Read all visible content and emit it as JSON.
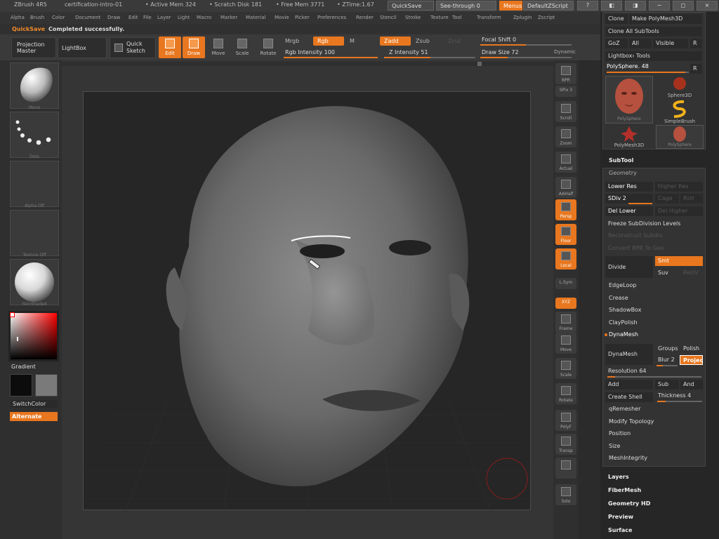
{
  "titlebar": {
    "app": "ZBrush 4R5",
    "file": "certification-intro-01",
    "active_mem": "• Active Mem 324",
    "scratch": "• Scratch Disk 181",
    "free_mem": "• Free Mem 3771",
    "ztime": "• ZTime:1.67",
    "quicksave": "QuickSave",
    "seethrough": "See-through 0",
    "menus": "Menus",
    "script": "DefaultZScript",
    "win_icons": [
      "?",
      "◧",
      "◨",
      "−",
      "◻",
      "×"
    ]
  },
  "menubar": [
    "Alpha",
    "Brush",
    "Color",
    "Document",
    "Draw",
    "Edit",
    "File",
    "Layer",
    "Light",
    "Macro",
    "Marker",
    "Material",
    "Movie",
    "Picker",
    "Preferences",
    "Render",
    "Stencil",
    "Stroke",
    "Texture",
    "Tool",
    "Transform",
    "Zplugin",
    "Zscript"
  ],
  "status": {
    "prefix": "QuickSave",
    "text": "Completed successfully."
  },
  "toolbar": {
    "projection_master": "Projection Master",
    "lightbox": "LightBox",
    "quick_sketch": "Quick Sketch",
    "edit": "Edit",
    "draw": "Draw",
    "move": "Move",
    "scale": "Scale",
    "rotate": "Rotate",
    "mrgb": "Mrgb",
    "rgb": "Rgb",
    "m": "M",
    "rgb_intensity": "Rgb Intensity 100",
    "rgb_intensity_value": 1.0,
    "zadd": "Zadd",
    "zsub": "Zsub",
    "zcut": "Zcut",
    "z_intensity": "Z Intensity 51",
    "z_intensity_value": 0.51,
    "focal_shift": "Focal Shift 0",
    "draw_size": "Draw Size 72",
    "dynamic": "Dynamic"
  },
  "leftshelf": {
    "brush_label": "Move",
    "stroke_label": "Dots",
    "alpha_label": "Alpha Off",
    "texture_label": "Texture Off",
    "material_label": "SkinShade4",
    "gradient": "Gradient",
    "switch_color": "SwitchColor",
    "alternate": "Alternate"
  },
  "rightshelf": [
    {
      "name": "bpr",
      "label": "BPR",
      "on": false
    },
    {
      "name": "spix",
      "label": "SPix 3",
      "on": false
    },
    {
      "name": "scroll",
      "label": "Scroll",
      "on": false
    },
    {
      "name": "zoom",
      "label": "Zoom",
      "on": false
    },
    {
      "name": "actual",
      "label": "Actual",
      "on": false
    },
    {
      "name": "aahalf",
      "label": "AAHalf",
      "on": false
    },
    {
      "name": "persp",
      "label": "Persp",
      "on": true
    },
    {
      "name": "floor",
      "label": "Floor",
      "on": true
    },
    {
      "name": "local",
      "label": "Local",
      "on": true
    },
    {
      "name": "lsym",
      "label": "L.Sym",
      "on": false
    },
    {
      "name": "xyz",
      "label": "XYZ",
      "on": true
    },
    {
      "name": "frame",
      "label": "Frame",
      "on": false
    },
    {
      "name": "move",
      "label": "Move",
      "on": false
    },
    {
      "name": "scale",
      "label": "Scale",
      "on": false
    },
    {
      "name": "rotate",
      "label": "Rotate",
      "on": false
    },
    {
      "name": "polyf",
      "label": "PolyF",
      "on": false
    },
    {
      "name": "transp",
      "label": "Transp",
      "on": false
    },
    {
      "name": "ghost",
      "label": "",
      "on": false
    },
    {
      "name": "solo",
      "label": "Solo",
      "on": false
    }
  ],
  "tool": {
    "clone": "Clone",
    "make_polymesh": "Make PolyMesh3D",
    "clone_all": "Clone All SubTools",
    "goz": "GoZ",
    "all": "All",
    "visible": "Visible",
    "r": "R",
    "lightbox_tools": "Lightbox› Tools",
    "current": "PolySphere. 48",
    "items": [
      {
        "label": "PolySphere",
        "kind": "head"
      },
      {
        "label": "Sphere3D",
        "kind": "sphere"
      },
      {
        "label": "SimpleBrush",
        "kind": "brush"
      },
      {
        "label": "PolyMesh3D",
        "kind": "star"
      },
      {
        "label": "PolySphere",
        "kind": "headsmall"
      }
    ]
  },
  "subtool": "SubTool",
  "geometry": {
    "title": "Geometry",
    "lower_res": "Lower Res",
    "higher_res": "Higher Res",
    "sdiv": "SDiv 2",
    "cage": "Cage",
    "rstr": "Rstr",
    "del_lower": "Del Lower",
    "del_higher": "Del Higher",
    "freeze": "Freeze SubDivision Levels",
    "reconstruct": "Reconstruct Subdiv",
    "convert_bpr": "Convert BPR To Geo",
    "divide": "Divide",
    "smt": "Smt",
    "suv": "Suv",
    "reuv": "ReUV",
    "edgeloop": "EdgeLoop",
    "crease": "Crease",
    "shadowbox": "ShadowBox",
    "claypolish": "ClayPolish",
    "dynamesh_header": "DynaMesh",
    "dynamesh": "DynaMesh",
    "groups": "Groups",
    "polish": "Polish",
    "blur": "Blur 2",
    "project": "Project",
    "resolution": "Resolution 64",
    "add": "Add",
    "sub": "Sub",
    "and": "And",
    "create_shell": "Create Shell",
    "thickness": "Thickness 4",
    "qremesher": "qRemesher",
    "modify_topology": "Modify Topology",
    "position": "Position",
    "size": "Size",
    "meshintegrity": "MeshIntegrity"
  },
  "palettes_below": [
    "Layers",
    "FiberMesh",
    "Geometry HD",
    "Preview",
    "Surface"
  ],
  "colors": {
    "accent": "#e8771f",
    "bg": "#2b2b2b",
    "canvas": "#262626",
    "mesh": "#6a6a6a"
  }
}
